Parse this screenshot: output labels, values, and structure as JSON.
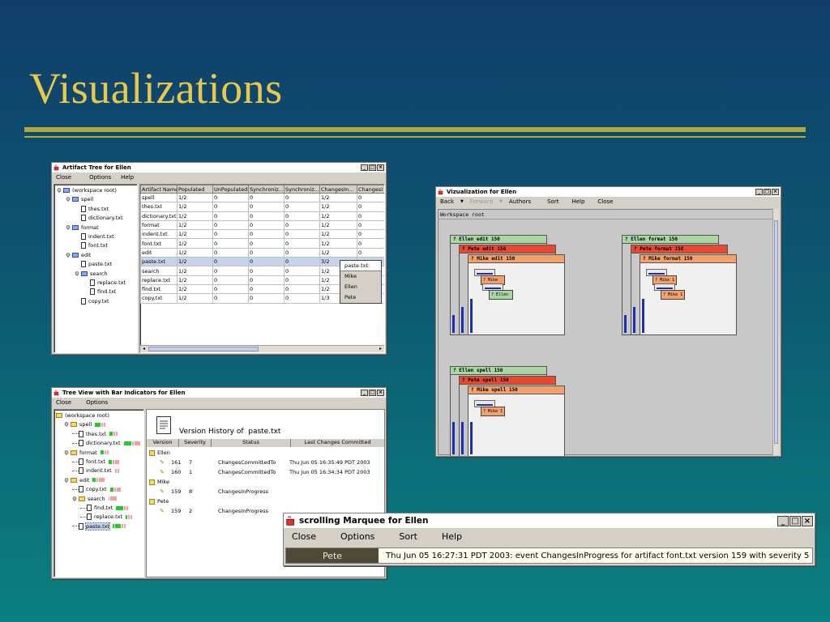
{
  "slide": {
    "title": "Visualizations"
  },
  "artifact_tree_window": {
    "title": "Artifact Tree for Ellen",
    "menu": [
      "Close",
      "Options",
      "Help"
    ],
    "tree": [
      {
        "label": "(workspace root)",
        "icon": "folder-icon",
        "depth": 0,
        "expander": true
      },
      {
        "label": "spell",
        "icon": "folder-icon",
        "depth": 1,
        "expander": true
      },
      {
        "label": "thes.txt",
        "icon": "document-icon",
        "depth": 2
      },
      {
        "label": "dictionary.txt",
        "icon": "document-icon",
        "depth": 2
      },
      {
        "label": "format",
        "icon": "folder-icon",
        "depth": 1,
        "expander": true
      },
      {
        "label": "indent.txt",
        "icon": "document-icon",
        "depth": 2
      },
      {
        "label": "font.txt",
        "icon": "document-icon",
        "depth": 2
      },
      {
        "label": "edit",
        "icon": "folder-icon",
        "depth": 1,
        "expander": true
      },
      {
        "label": "paste.txt",
        "icon": "document-icon",
        "depth": 2
      },
      {
        "label": "search",
        "icon": "folder-icon",
        "depth": 2,
        "expander": true
      },
      {
        "label": "replace.txt",
        "icon": "document-icon",
        "depth": 3
      },
      {
        "label": "find.txt",
        "icon": "document-icon",
        "depth": 3
      },
      {
        "label": "copy.txt",
        "icon": "document-icon",
        "depth": 2
      }
    ],
    "columns": [
      "Artifact Name",
      "Populated",
      "UnPopulated",
      "Synchroniz...",
      "Synchroniz...",
      "ChangesIn...",
      "ChangesI"
    ],
    "rows": [
      [
        "spell",
        "1/2",
        "0",
        "0",
        "0",
        "1/2",
        "0"
      ],
      [
        "thes.txt",
        "1/2",
        "0",
        "0",
        "0",
        "1/2",
        "0"
      ],
      [
        "dictionary.txt",
        "1/2",
        "0",
        "0",
        "0",
        "1/2",
        "0"
      ],
      [
        "format",
        "1/2",
        "0",
        "0",
        "0",
        "1/2",
        "0"
      ],
      [
        "indent.txt",
        "1/2",
        "0",
        "0",
        "0",
        "1/2",
        "0"
      ],
      [
        "font.txt",
        "1/2",
        "0",
        "0",
        "0",
        "1/2",
        "0"
      ],
      [
        "edit",
        "1/2",
        "0",
        "0",
        "0",
        "1/2",
        "0"
      ],
      [
        "paste.txt",
        "1/2",
        "0",
        "0",
        "0",
        "3/2",
        ""
      ],
      [
        "search",
        "1/2",
        "0",
        "0",
        "0",
        "1/2",
        ""
      ],
      [
        "replace.txt",
        "1/2",
        "0",
        "0",
        "0",
        "1/2",
        ""
      ],
      [
        "find.txt",
        "1/2",
        "0",
        "0",
        "0",
        "1/2",
        ""
      ],
      [
        "copy.txt",
        "1/2",
        "0",
        "0",
        "0",
        "1/3",
        ""
      ]
    ],
    "selected_row": 7,
    "context_menu": {
      "header": "paste.txt:",
      "items": [
        "Mike",
        "Ellen",
        "Pete"
      ]
    }
  },
  "visualization_window": {
    "title": "Vizualization for Ellen",
    "menu": [
      "Back",
      "Forward",
      "Authors",
      "Sort",
      "Help",
      "Close"
    ],
    "root_label": "Workspace root",
    "groups": [
      {
        "layers": [
          {
            "label": "? Ellen edit 150",
            "color": "#a9d6a2"
          },
          {
            "label": "? Pete edit 150",
            "color": "#e8482e"
          },
          {
            "label": "? Mike edit 150",
            "color": "#f4a06a"
          }
        ],
        "minis": [
          "? Mike",
          "? Ellen"
        ]
      },
      {
        "layers": [
          {
            "label": "? Ellen format 150",
            "color": "#a9d6a2"
          },
          {
            "label": "? Pete format 150",
            "color": "#e8482e"
          },
          {
            "label": "? Mike format 150",
            "color": "#f4a06a"
          }
        ],
        "minis": [
          "? Mike 1",
          "? Mike 1"
        ]
      },
      {
        "layers": [
          {
            "label": "? Ellen spell 150",
            "color": "#a9d6a2"
          },
          {
            "label": "? Pete spell 150",
            "color": "#e8482e"
          },
          {
            "label": "? Mike spell 150",
            "color": "#f4a06a"
          }
        ],
        "minis": [
          "? Mike 1"
        ]
      }
    ]
  },
  "bar_tree_window": {
    "title": "Tree View with Bar Indicators for Ellen",
    "menu": [
      "Close",
      "Options"
    ],
    "tree": [
      {
        "label": "(workspace root)",
        "depth": 0,
        "folder": true,
        "bars": []
      },
      {
        "label": "spell",
        "depth": 1,
        "folder": true,
        "bars": [
          [
            "#22cc22",
            7
          ],
          [
            "#f4a0a0",
            2
          ],
          [
            "#f4a0a0",
            2
          ]
        ]
      },
      {
        "label": "thes.txt",
        "depth": 2,
        "folder": false,
        "bars": [
          [
            "#22cc22",
            4
          ],
          [
            "#f4a0a0",
            2
          ],
          [
            "#f4a0a0",
            2
          ]
        ]
      },
      {
        "label": "dictionary.txt",
        "depth": 2,
        "folder": false,
        "bars": [
          [
            "#22cc22",
            9
          ],
          [
            "#f4a0a0",
            2
          ],
          [
            "#f4a0a0",
            7
          ]
        ]
      },
      {
        "label": "format",
        "depth": 1,
        "folder": true,
        "bars": [
          [
            "#22cc22",
            4
          ],
          [
            "#f4a0a0",
            2
          ],
          [
            "#f4a0a0",
            2
          ]
        ]
      },
      {
        "label": "font.txt",
        "depth": 2,
        "folder": false,
        "bars": [
          [
            "#22cc22",
            4
          ],
          [
            "#f4a0a0",
            2
          ],
          [
            "#f4a0a0",
            5
          ]
        ]
      },
      {
        "label": "indent.txt",
        "depth": 2,
        "folder": false,
        "bars": [
          [
            "#f4a0a0",
            2
          ],
          [
            "#f4a0a0",
            2
          ]
        ]
      },
      {
        "label": "edit",
        "depth": 1,
        "folder": true,
        "bars": [
          [
            "#22cc22",
            4
          ],
          [
            "#f4a0a0",
            2
          ],
          [
            "#f4a0a0",
            7
          ]
        ]
      },
      {
        "label": "copy.txt",
        "depth": 2,
        "folder": false,
        "bars": [
          [
            "#22cc22",
            4
          ],
          [
            "#f4a0a0",
            2
          ],
          [
            "#f4a0a0",
            5
          ]
        ]
      },
      {
        "label": "search",
        "depth": 2,
        "folder": true,
        "bars": [
          [
            "#f4a0a0",
            1
          ],
          [
            "#f4a0a0",
            8
          ]
        ]
      },
      {
        "label": "find.txt",
        "depth": 3,
        "folder": false,
        "bars": [
          [
            "#22cc22",
            9
          ],
          [
            "#f4a0a0",
            2
          ],
          [
            "#f4a0a0",
            2
          ]
        ]
      },
      {
        "label": "replace.txt",
        "depth": 3,
        "folder": false,
        "bars": [
          [
            "#22cc22",
            2
          ],
          [
            "#f4a0a0",
            2
          ],
          [
            "#f4a0a0",
            2
          ]
        ]
      },
      {
        "label": "paste.txt",
        "depth": 2,
        "folder": false,
        "selected": true,
        "bars": [
          [
            "#22cc22",
            2
          ],
          [
            "#22cc22",
            7
          ],
          [
            "#f4a0a0",
            2
          ],
          [
            "#f4a0a0",
            2
          ]
        ]
      }
    ],
    "history": {
      "title": "Version History of  paste.txt",
      "columns": [
        "Version",
        "Severity",
        "Status",
        "Last Changes Committed"
      ],
      "groups": [
        {
          "author": "Ellen",
          "entries": [
            {
              "version": "161",
              "severity": "7",
              "status": "ChangesCommittedTo",
              "committed": "Thu Jun 05 16:35:49 PDT 2003"
            },
            {
              "version": "160",
              "severity": "1",
              "status": "ChangesCommittedTo",
              "committed": "Thu Jun 05 16:34:34 PDT 2003"
            }
          ]
        },
        {
          "author": "Mike",
          "entries": [
            {
              "version": "159",
              "severity": "8",
              "status": "ChangesInProgress",
              "committed": ""
            }
          ]
        },
        {
          "author": "Pete",
          "entries": [
            {
              "version": "159",
              "severity": "2",
              "status": "ChangesInProgress",
              "committed": ""
            }
          ]
        }
      ]
    }
  },
  "marquee_window": {
    "title": "scrolling Marquee for Ellen",
    "menu": [
      "Close",
      "Options",
      "Sort",
      "Help"
    ],
    "author": "Pete",
    "message": "Thu Jun 05 16:27:31 PDT 2003: event ChangesInProgress for artifact font.txt version 159 with severity 5"
  }
}
